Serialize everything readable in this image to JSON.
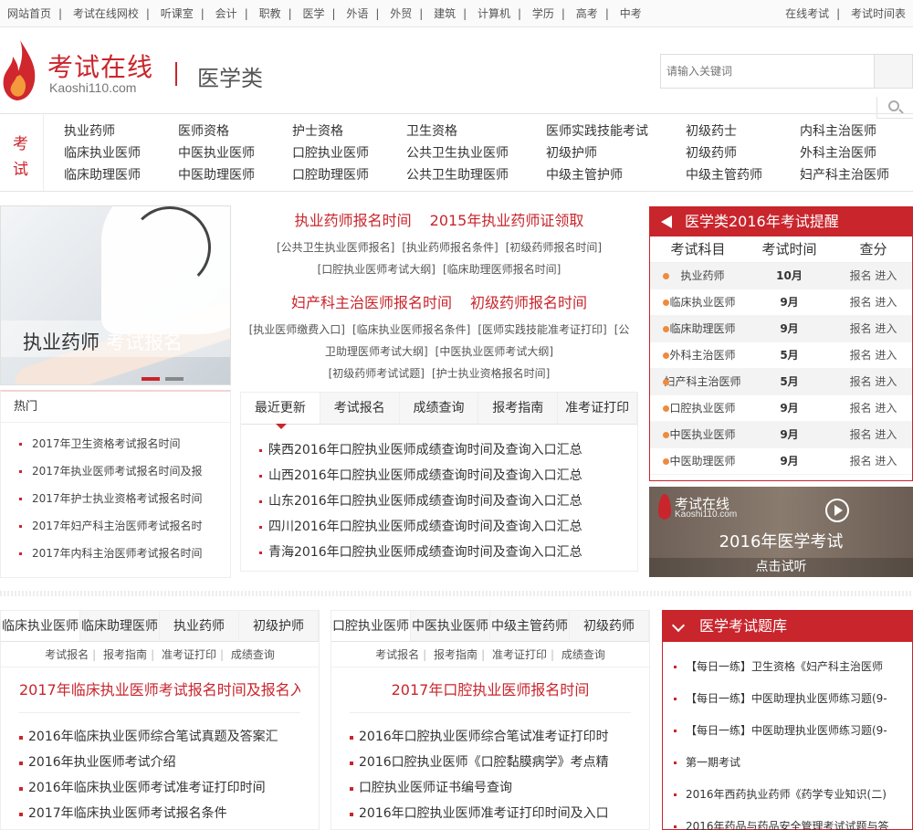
{
  "topnav": {
    "links": [
      "网站首页",
      "考试在线网校",
      "听课室",
      "会计",
      "职教",
      "医学",
      "外语",
      "外贸",
      "建筑",
      "计算机",
      "学历",
      "高考",
      "中考"
    ],
    "right": [
      "在线考试",
      "考试时间表"
    ]
  },
  "header": {
    "logo_title": "考试在线",
    "logo_sub": "Kaoshi110.com",
    "category": "医学类",
    "search_placeholder": "请输入关键词"
  },
  "examnav": {
    "tag": [
      "考",
      "试"
    ],
    "rows": [
      [
        "执业药师",
        "医师资格",
        "护士资格",
        "卫生资格",
        "医师实践技能考试",
        "初级药士",
        "内科主治医师"
      ],
      [
        "临床执业医师",
        "中医执业医师",
        "口腔执业医师",
        "公共卫生执业医师",
        "初级护师",
        "初级药师",
        "外科主治医师"
      ],
      [
        "临床助理医师",
        "中医助理医师",
        "口腔助理医师",
        "公共卫生助理医师",
        "中级主管护师",
        "中级主管药师",
        "妇产科主治医师"
      ]
    ]
  },
  "banner": {
    "label_a": "执业药师",
    "label_b": "考试报名"
  },
  "headlines": {
    "h1": [
      "执业药师报名时间",
      "2015年执业药师证领取"
    ],
    "s1": [
      "[公共卫生执业医师报名]",
      "[执业药师报名条件]",
      "[初级药师报名时间]"
    ],
    "s2": [
      "[口腔执业医师考试大纲]",
      "[临床助理医师报名时间]"
    ],
    "h2": [
      "妇产科主治医师报名时间",
      "初级药师报名时间"
    ],
    "s3": [
      "[执业医师缴费入口]",
      "[临床执业医师报名条件]",
      "[医师实践技能准考证打印]",
      "[公"
    ],
    "s4": [
      "卫助理医师考试大纲]",
      "[中医执业医师考试大纲]"
    ],
    "s5": [
      "[初级药师考试试题]",
      "[护士执业资格报名时间]"
    ]
  },
  "remind": {
    "title": "医学类2016年考试提醒",
    "cols": [
      "考试科目",
      "考试时间",
      "查分"
    ],
    "rows": [
      {
        "name": "执业药师",
        "time": "10月",
        "act": "报名  进入"
      },
      {
        "name": "临床执业医师",
        "time": "9月",
        "act": "报名  进入"
      },
      {
        "name": "临床助理医师",
        "time": "9月",
        "act": "报名  进入"
      },
      {
        "name": "外科主治医师",
        "time": "5月",
        "act": "报名  进入"
      },
      {
        "name": "妇产科主治医师",
        "time": "5月",
        "act": "报名  进入"
      },
      {
        "name": "口腔执业医师",
        "time": "9月",
        "act": "报名  进入"
      },
      {
        "name": "中医执业医师",
        "time": "9月",
        "act": "报名  进入"
      },
      {
        "name": "中医助理医师",
        "time": "9月",
        "act": "报名  进入"
      }
    ]
  },
  "video": {
    "logo": "考试在线",
    "logo_sub": "Kaoshi110.com",
    "title": "2016年医学考试",
    "button": "点击试听"
  },
  "hot": {
    "title": "热门",
    "items": [
      "2017年卫生资格考试报名时间",
      "2017年执业医师考试报名时间及报",
      "2017年护士执业资格考试报名时间",
      "2017年妇产科主治医师考试报名时",
      "2017年内科主治医师考试报名时间"
    ]
  },
  "news": {
    "tabs": [
      "最近更新",
      "考试报名",
      "成绩查询",
      "报考指南",
      "准考证打印"
    ],
    "items": [
      "陕西2016年口腔执业医师成绩查询时间及查询入口汇总",
      "山西2016年口腔执业医师成绩查询时间及查询入口汇总",
      "山东2016年口腔执业医师成绩查询时间及查询入口汇总",
      "四川2016年口腔执业医师成绩查询时间及查询入口汇总",
      "青海2016年口腔执业医师成绩查询时间及查询入口汇总"
    ]
  },
  "panel1": {
    "tabs": [
      "临床执业医师",
      "临床助理医师",
      "执业药师",
      "初级护师"
    ],
    "sub": [
      "考试报名",
      "报考指南",
      "准考证打印",
      "成绩查询"
    ],
    "title": "2017年临床执业医师考试报名时间及报名入",
    "items": [
      "2016年临床执业医师综合笔试真题及答案汇",
      "2016年执业医师考试介绍",
      "2016年临床执业医师考试准考证打印时间",
      "2017年临床执业医师考试报名条件"
    ]
  },
  "panel2": {
    "tabs": [
      "口腔执业医师",
      "中医执业医师",
      "中级主管药师",
      "初级药师"
    ],
    "sub": [
      "考试报名",
      "报考指南",
      "准考证打印",
      "成绩查询"
    ],
    "title": "2017年口腔执业医师报名时间",
    "items": [
      "2016年口腔执业医师综合笔试准考证打印时",
      "2016口腔执业医师《口腔黏膜病学》考点精",
      "口腔执业医师证书编号查询",
      "2016年口腔执业医师准考证打印时间及入口"
    ]
  },
  "bank": {
    "title": "医学考试题库",
    "items": [
      "【每日一练】卫生资格《妇产科主治医师",
      "【每日一练】中医助理执业医师练习题(9-",
      "【每日一练】中医助理执业医师练习题(9-",
      "第一期考试",
      "2016年西药执业药师《药学专业知识(二)",
      "2016年药品与药品安全管理考试试题与答"
    ]
  }
}
